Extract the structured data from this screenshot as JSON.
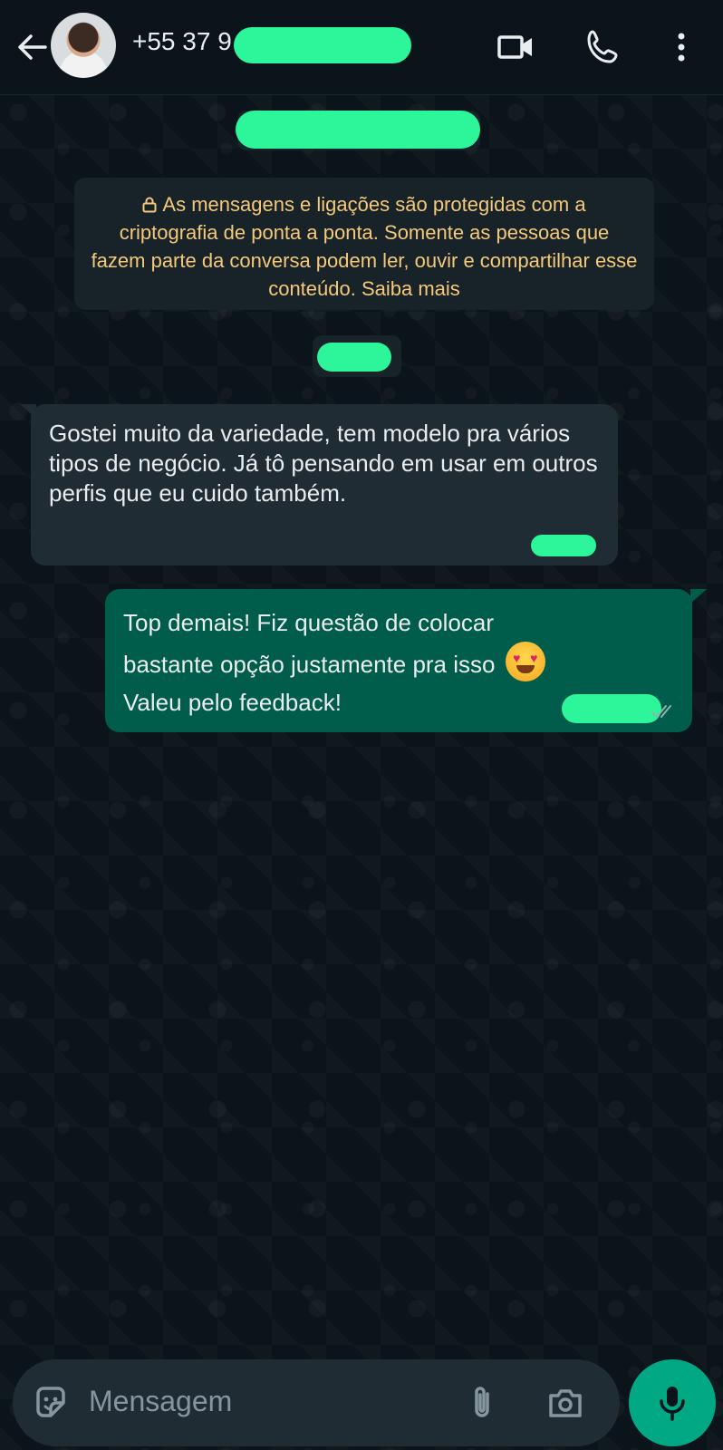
{
  "header": {
    "contact_name": "+55 37 9",
    "back_icon": "arrow-left-icon",
    "video_icon": "video-call-icon",
    "call_icon": "phone-icon",
    "menu_icon": "more-vert-icon"
  },
  "chat": {
    "encryption_notice": "As mensagens e ligações são protegidas com a criptografia de ponta a ponta. Somente as pessoas que fazem parte da conversa podem ler, ouvir e compartilhar esse conteúdo. Saiba mais",
    "messages": [
      {
        "direction": "incoming",
        "text": "Gostei muito da variedade, tem modelo pra vários tipos de negócio. Já tô pensando em usar em outros perfis que eu cuido também."
      },
      {
        "direction": "outgoing",
        "line1": "Top demais! Fiz questão de colocar",
        "line2": "bastante opção justamente pra isso",
        "line3": "Valeu pelo feedback!",
        "emoji": "heart-eyes-emoji",
        "status": "read"
      }
    ]
  },
  "composer": {
    "placeholder": "Mensagem",
    "sticker_icon": "sticker-icon",
    "attach_icon": "paperclip-icon",
    "camera_icon": "camera-icon",
    "mic_icon": "microphone-icon"
  },
  "colors": {
    "background": "#0b141a",
    "incoming_bubble": "#202c33",
    "outgoing_bubble": "#005c4b",
    "accent": "#00a884",
    "notice_text": "#f5c97a",
    "redaction": "#2df59a"
  }
}
